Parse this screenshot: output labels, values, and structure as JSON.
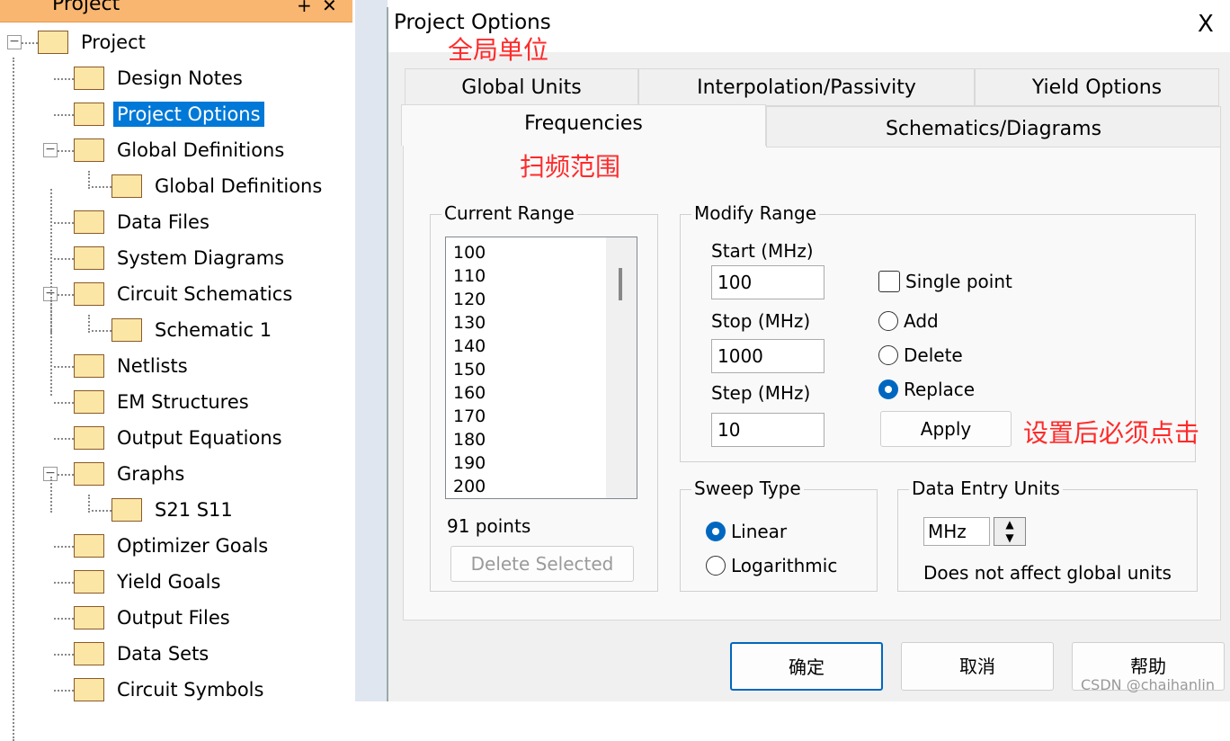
{
  "left_panel": {
    "header": "Project",
    "tree": [
      {
        "label": "Project",
        "level": 0
      },
      {
        "label": "Design Notes",
        "level": 1
      },
      {
        "label": "Project Options",
        "level": 1,
        "selected": true
      },
      {
        "label": "Global Definitions",
        "level": 1
      },
      {
        "label": "Global Definitions",
        "level": 2
      },
      {
        "label": "Data Files",
        "level": 1
      },
      {
        "label": "System Diagrams",
        "level": 1
      },
      {
        "label": "Circuit Schematics",
        "level": 1
      },
      {
        "label": "Schematic 1",
        "level": 2
      },
      {
        "label": "Netlists",
        "level": 1
      },
      {
        "label": "EM Structures",
        "level": 1
      },
      {
        "label": "Output Equations",
        "level": 1
      },
      {
        "label": "Graphs",
        "level": 1
      },
      {
        "label": "S21 S11",
        "level": 2
      },
      {
        "label": "Optimizer Goals",
        "level": 1
      },
      {
        "label": "Yield Goals",
        "level": 1
      },
      {
        "label": "Output Files",
        "level": 1
      },
      {
        "label": "Data Sets",
        "level": 1
      },
      {
        "label": "Circuit Symbols",
        "level": 1
      }
    ]
  },
  "dialog": {
    "title": "Project Options",
    "close": "X",
    "tabs_row1": [
      "Global Units",
      "Interpolation/Passivity",
      "Yield Options"
    ],
    "tabs_row2": [
      "Frequencies",
      "Schematics/Diagrams"
    ],
    "active_tab": "Frequencies",
    "current_range": {
      "label": "Current Range",
      "values": [
        "100",
        "110",
        "120",
        "130",
        "140",
        "150",
        "160",
        "170",
        "180",
        "190",
        "200"
      ],
      "count": "91 points",
      "delete_button": "Delete Selected"
    },
    "modify_range": {
      "label": "Modify Range",
      "start_label": "Start (MHz)",
      "start": "100",
      "stop_label": "Stop (MHz)",
      "stop": "1000",
      "step_label": "Step (MHz)",
      "step": "10",
      "single_point": "Single point",
      "add": "Add",
      "delete": "Delete",
      "replace": "Replace",
      "apply": "Apply",
      "selected": "Replace"
    },
    "sweep_type": {
      "label": "Sweep Type",
      "linear": "Linear",
      "log": "Logarithmic",
      "selected": "Linear"
    },
    "data_entry_units": {
      "label": "Data Entry Units",
      "value": "MHz",
      "note": "Does not affect global units"
    },
    "buttons": {
      "ok": "确定",
      "cancel": "取消",
      "help": "帮助"
    }
  },
  "annotations": {
    "global_units": "全局单位",
    "sweep_range": "扫频范围",
    "apply_note": "设置后必须点击"
  },
  "watermark": "CSDN @chaihanlin"
}
